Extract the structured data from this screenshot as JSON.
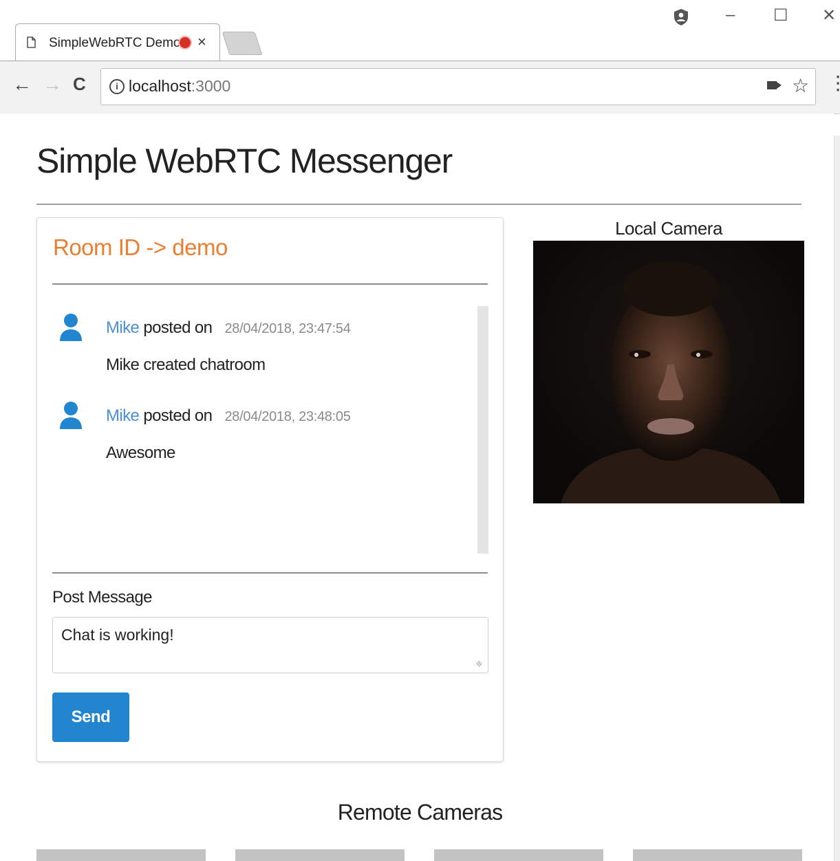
{
  "browser": {
    "tab_title": "SimpleWebRTC Demo",
    "tab_close": "×",
    "url_host": "localhost",
    "url_port": ":3000",
    "window_controls": {
      "minimize": "–",
      "maximize": "☐",
      "close": "✕"
    },
    "nav": {
      "back": "←",
      "forward": "→",
      "reload": "C"
    },
    "icons": [
      "page-icon",
      "recording-icon",
      "close-icon",
      "profile-icon",
      "info-icon",
      "camera-icon",
      "star-icon",
      "menu-icon"
    ]
  },
  "page": {
    "title": "Simple WebRTC Messenger",
    "room": {
      "title": "Room ID -> demo"
    },
    "messages": [
      {
        "author": "Mike",
        "posted": "posted on",
        "time": "28/04/2018, 23:47:54",
        "text": "Mike created chatroom"
      },
      {
        "author": "Mike",
        "posted": "posted on",
        "time": "28/04/2018, 23:48:05",
        "text": "Awesome"
      }
    ],
    "post": {
      "label": "Post Message",
      "value": "Chat is working!",
      "send_label": "Send"
    },
    "local_camera_label": "Local Camera",
    "remote_cameras_title": "Remote Cameras",
    "remote_tile_count": 4
  },
  "colors": {
    "accent_orange": "#ed7d2f",
    "author_blue": "#4a90d9",
    "button_blue": "#2185d0",
    "avatar_blue": "#2185d0"
  }
}
